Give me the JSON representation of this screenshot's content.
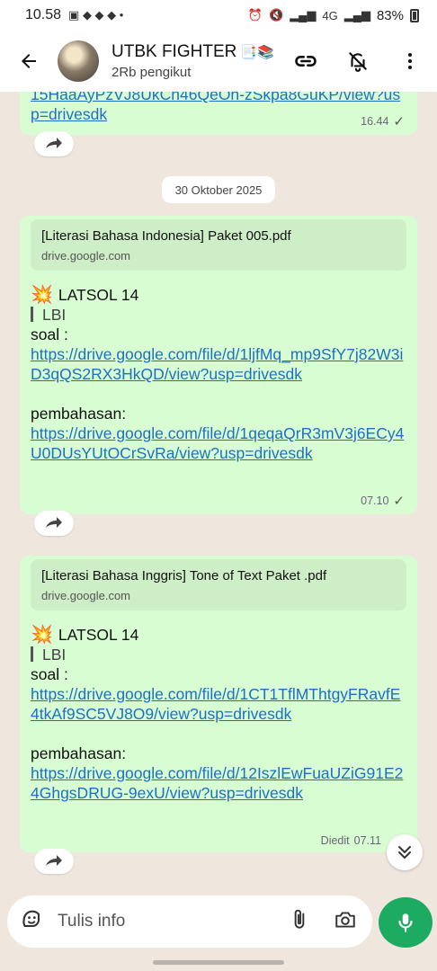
{
  "status_bar": {
    "time": "10.58",
    "battery": "83%",
    "network": "4G"
  },
  "header": {
    "channel_name": "UTBK FIGHTER",
    "channel_emoji": "📑📚",
    "followers": "2Rb pengikut"
  },
  "messages": [
    {
      "partial_link": "15HaaAyPzVJ8UkCh46QeOh-zSkpa8GuKP/view?usp=drivesdk",
      "time": "16.44"
    },
    {
      "date": "30 Oktober 2025"
    },
    {
      "card_title": "[Literasi Bahasa Indonesia] Paket 005.pdf",
      "card_domain": "drive.google.com",
      "heading": "LATSOL 14",
      "quote": "LBI",
      "soal_label": "soal :",
      "soal_link": "https://drive.google.com/file/d/1ljfMq_mp9SfY7j82W3iD3qQS2RX3HkQD/view?usp=drivesdk",
      "pembahasan_label": "pembahasan:",
      "pembahasan_link": "https://drive.google.com/file/d/1qeqaQrR3mV3j6ECy4U0DUsYUtOCrSvRa/view?usp=drivesdk",
      "time": "07.10"
    },
    {
      "card_title": "[Literasi Bahasa Inggris] Tone of Text Paket .pdf",
      "card_domain": "drive.google.com",
      "heading": "LATSOL 14",
      "quote": "LBI",
      "soal_label": "soal :",
      "soal_link": "https://drive.google.com/file/d/1CT1TflMThtgyFRavfE4tkAf9SC5VJ8O9/view?usp=drivesdk",
      "pembahasan_label": "pembahasan:",
      "pembahasan_link": "https://drive.google.com/file/d/12IszlEwFuaUZiG91E24GhgsDRUG-9exU/view?usp=drivesdk",
      "edited_label": "Diedit",
      "time": "07.11"
    }
  ],
  "input": {
    "placeholder": "Tulis info"
  },
  "colors": {
    "bubble": "#d9fdd3",
    "link": "#1d6fc4",
    "mic": "#1daa61",
    "background": "#efe7de"
  }
}
